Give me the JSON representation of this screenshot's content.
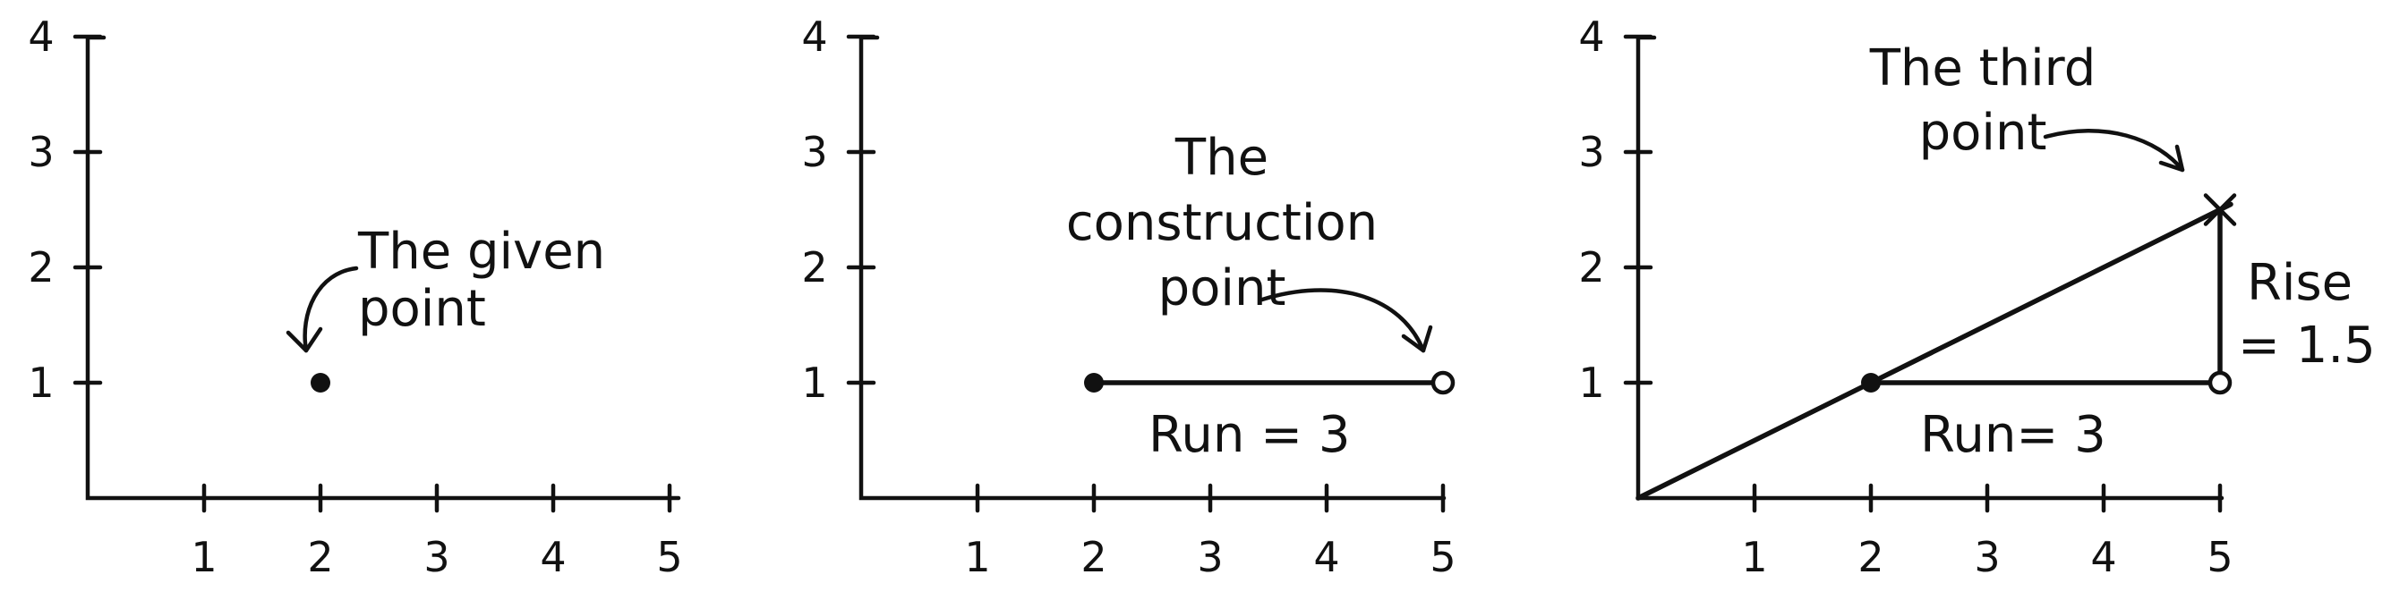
{
  "chart_data": [
    {
      "type": "scatter",
      "xlim": [
        0,
        5
      ],
      "ylim": [
        0,
        4
      ],
      "x_ticks": [
        "1",
        "2",
        "3",
        "4",
        "5"
      ],
      "y_ticks": [
        "1",
        "2",
        "3",
        "4"
      ],
      "points": [
        {
          "x": 2,
          "y": 1,
          "style": "filled"
        }
      ],
      "annotations": [
        {
          "lines": [
            "The given",
            "point"
          ],
          "target": {
            "x": 2,
            "y": 1
          }
        }
      ]
    },
    {
      "type": "scatter",
      "xlim": [
        0,
        5
      ],
      "ylim": [
        0,
        4
      ],
      "x_ticks": [
        "1",
        "2",
        "3",
        "4",
        "5"
      ],
      "y_ticks": [
        "1",
        "2",
        "3",
        "4"
      ],
      "points": [
        {
          "x": 2,
          "y": 1,
          "style": "filled"
        },
        {
          "x": 5,
          "y": 1,
          "style": "open"
        }
      ],
      "segments": [
        {
          "from": {
            "x": 2,
            "y": 1
          },
          "to": {
            "x": 5,
            "y": 1
          }
        }
      ],
      "labels": [
        "Run = 3"
      ],
      "annotations": [
        {
          "lines": [
            "The",
            "construction",
            "point"
          ],
          "target": {
            "x": 5,
            "y": 1
          }
        }
      ]
    },
    {
      "type": "line",
      "xlim": [
        0,
        5
      ],
      "ylim": [
        0,
        4
      ],
      "x_ticks": [
        "1",
        "2",
        "3",
        "4",
        "5"
      ],
      "y_ticks": [
        "1",
        "2",
        "3",
        "4"
      ],
      "line": {
        "from": {
          "x": 0,
          "y": 0
        },
        "to": {
          "x": 5,
          "y": 2.5
        }
      },
      "points": [
        {
          "x": 2,
          "y": 1,
          "style": "filled"
        },
        {
          "x": 5,
          "y": 1,
          "style": "open"
        },
        {
          "x": 5,
          "y": 2.5,
          "style": "cross"
        }
      ],
      "segments": [
        {
          "from": {
            "x": 2,
            "y": 1
          },
          "to": {
            "x": 5,
            "y": 1
          }
        },
        {
          "from": {
            "x": 5,
            "y": 1
          },
          "to": {
            "x": 5,
            "y": 2.5
          }
        }
      ],
      "labels": [
        "Run= 3",
        "Rise",
        "= 1.5"
      ],
      "annotations": [
        {
          "lines": [
            "The third",
            "point"
          ],
          "target": {
            "x": 5,
            "y": 2.5
          }
        }
      ]
    }
  ]
}
